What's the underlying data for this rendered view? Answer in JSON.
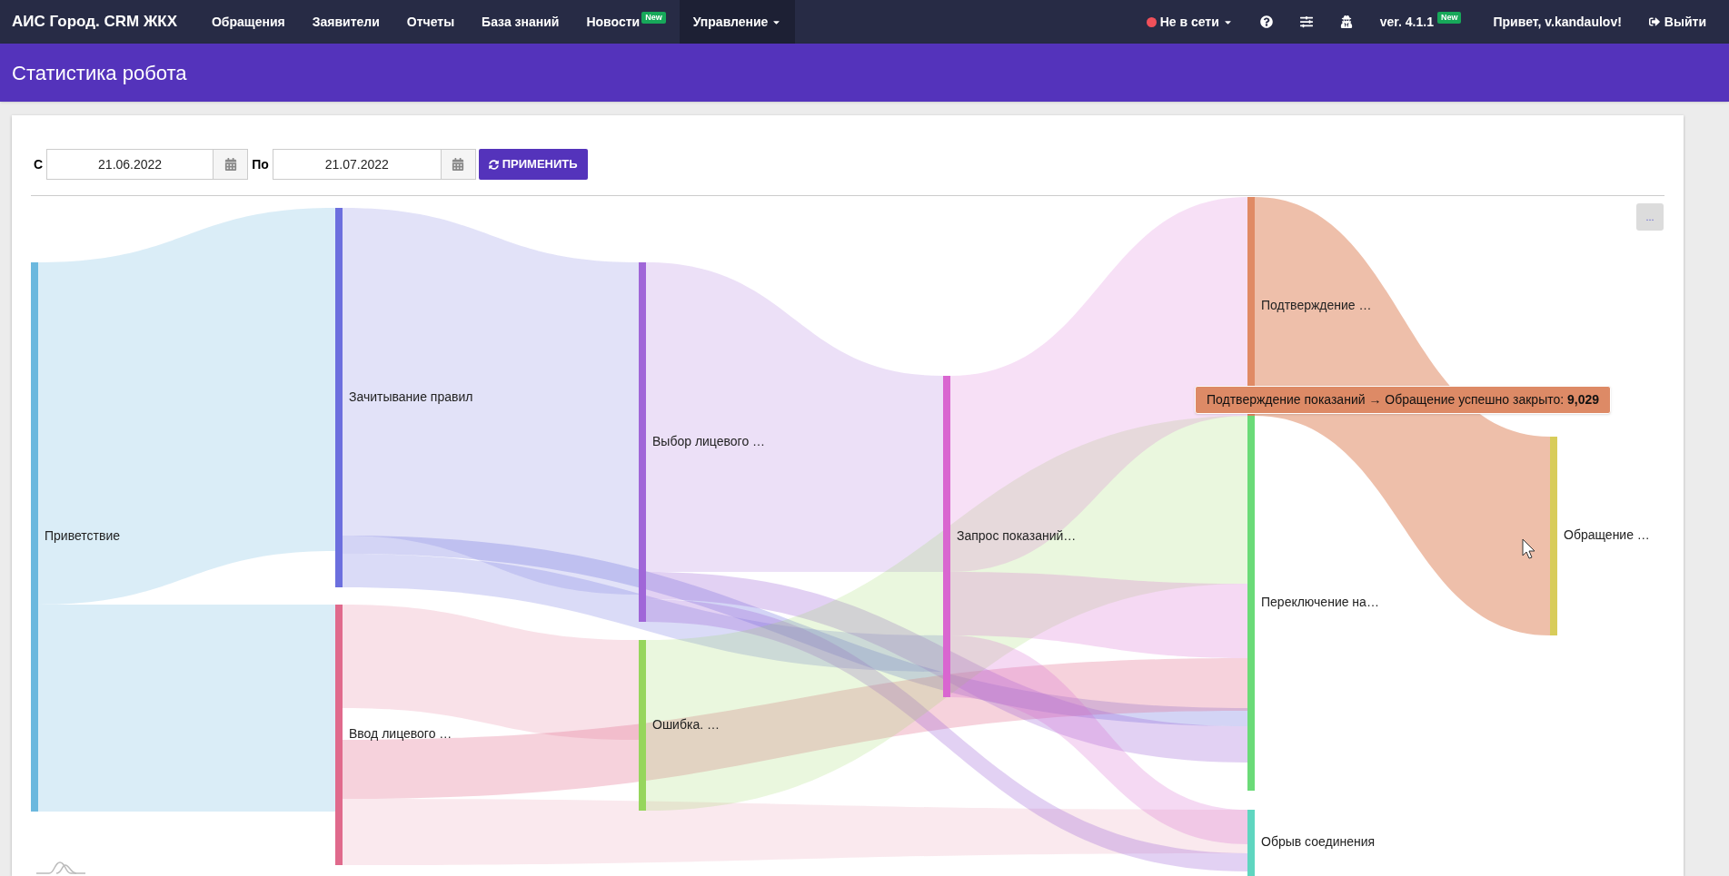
{
  "nav": {
    "brand": "АИС Город. CRM ЖКХ",
    "items": [
      {
        "label": "Обращения",
        "selected": false,
        "dropdown": false
      },
      {
        "label": "Заявители",
        "selected": false,
        "dropdown": false
      },
      {
        "label": "Отчеты",
        "selected": false,
        "dropdown": false
      },
      {
        "label": "База знаний",
        "selected": false,
        "dropdown": false
      },
      {
        "label": "Новости",
        "badge": "New",
        "selected": false,
        "dropdown": false
      },
      {
        "label": "Управление",
        "selected": true,
        "dropdown": true
      }
    ],
    "status": {
      "label": "Не в сети",
      "color": "#f0505a"
    },
    "version": {
      "label": "ver. 4.1.1",
      "badge": "New"
    },
    "greeting": "Привет, v.kandaulov!",
    "logout": "Выйти"
  },
  "page_title": "Статистика робота",
  "filter": {
    "from_label": "С",
    "from_value": "21.06.2022",
    "to_label": "По",
    "to_value": "21.07.2022",
    "apply_button": "ПРИМЕНИТЬ"
  },
  "chart": {
    "menu_button": "...",
    "nodes": [
      {
        "label": "Приветствие",
        "color": "#6bb8de"
      },
      {
        "label": "Зачитывание правил",
        "color": "#6c6fde"
      },
      {
        "label": "Ввод лицевого …",
        "color": "#e06a8c"
      },
      {
        "label": "Выбор лицевого …",
        "color": "#a066d8"
      },
      {
        "label": "Ошибка. …",
        "color": "#96d65c"
      },
      {
        "label": "Запрос показаний…",
        "color": "#d966d0"
      },
      {
        "label": "Подтверждение …",
        "color": "#e08a64"
      },
      {
        "label": "Переключение на…",
        "color": "#6bdb78"
      },
      {
        "label": "Обрыв соединения",
        "color": "#5fd6c0"
      },
      {
        "label": "Обращение …",
        "color": "#d8cc5a"
      }
    ],
    "tooltip": {
      "text": "Подтверждение показаний → Обращение успешно закрыто:",
      "value": "9,029"
    }
  }
}
